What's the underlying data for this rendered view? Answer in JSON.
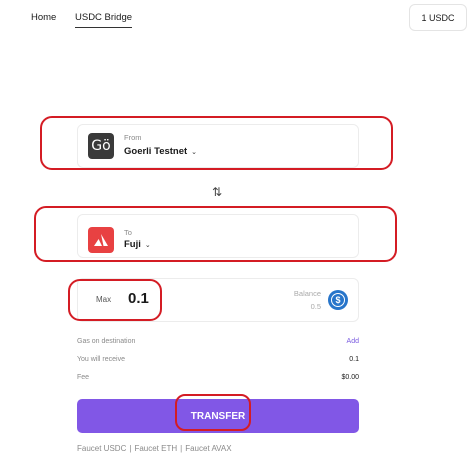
{
  "nav": {
    "home": "Home",
    "bridge": "USDC Bridge",
    "balance": "1 USDC"
  },
  "from": {
    "caption": "From",
    "network": "Goerli Testnet",
    "icon_glyph": "Gö"
  },
  "to": {
    "caption": "To",
    "network": "Fuji"
  },
  "amount": {
    "max_label": "Max",
    "value": "0.1",
    "balance_label": "Balance",
    "balance_value": "0.5"
  },
  "details": {
    "gas_label": "Gas on destination",
    "gas_action": "Add",
    "receive_label": "You will receive",
    "receive_value": "0.1",
    "fee_label": "Fee",
    "fee_value": "$0.00"
  },
  "transfer_label": "TRANSFER",
  "faucets": {
    "usdc": "Faucet USDC",
    "eth": "Faucet ETH",
    "avax": "Faucet AVAX",
    "separator": "|"
  },
  "colors": {
    "accent": "#8157e6",
    "annotation": "#d41c24",
    "link": "#7a5be0",
    "usdc": "#2775ca",
    "avalanche": "#e84142"
  }
}
